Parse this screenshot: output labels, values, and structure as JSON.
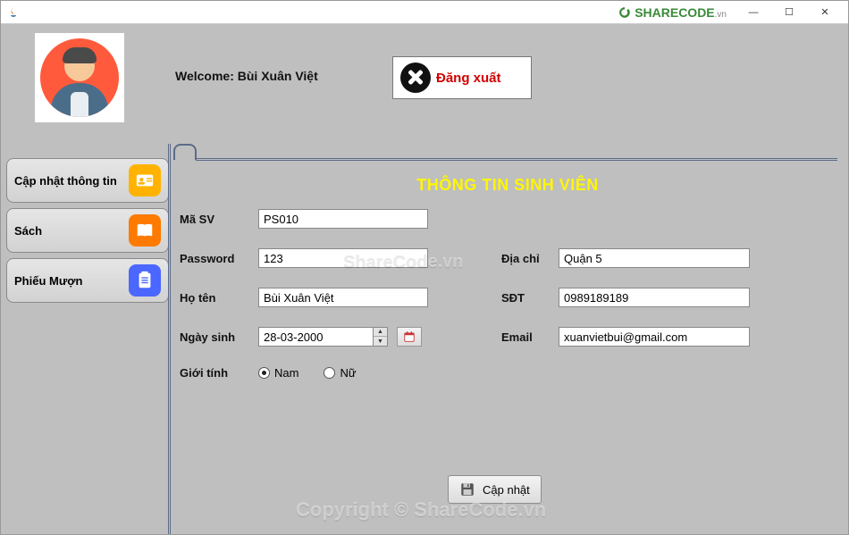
{
  "watermark_brand": "SHARECODE",
  "watermark_suffix": ".vn",
  "welcome_prefix": "Welcome: ",
  "welcome_user": "Bùi Xuân Việt",
  "logout_label": "Đăng xuất",
  "sidebar": {
    "items": [
      {
        "label": "Cập nhật thông tin",
        "icon": "id-card-icon"
      },
      {
        "label": "Sách",
        "icon": "book-icon"
      },
      {
        "label": "Phiếu Mượn",
        "icon": "clipboard-icon"
      }
    ]
  },
  "panel": {
    "title": "THÔNG TIN SINH VIÊN",
    "fields": {
      "masv_label": "Mã SV",
      "masv_value": "PS010",
      "password_label": "Password",
      "password_value": "123",
      "hoten_label": "Họ tên",
      "hoten_value": "Bùi Xuân Việt",
      "ngaysinh_label": "Ngày sinh",
      "ngaysinh_value": "28-03-2000",
      "gioitinh_label": "Giới tính",
      "gioitinh_nam": "Nam",
      "gioitinh_nu": "Nữ",
      "gioitinh_selected": "Nam",
      "diachi_label": "Địa chỉ",
      "diachi_value": "Quận 5",
      "sdt_label": "SĐT",
      "sdt_value": "0989189189",
      "email_label": "Email",
      "email_value": "xuanvietbui@gmail.com"
    },
    "update_button": "Cập nhật"
  },
  "overlay_watermarks": {
    "center": "ShareCode.vn",
    "bottom": "Copyright © ShareCode.vn"
  }
}
